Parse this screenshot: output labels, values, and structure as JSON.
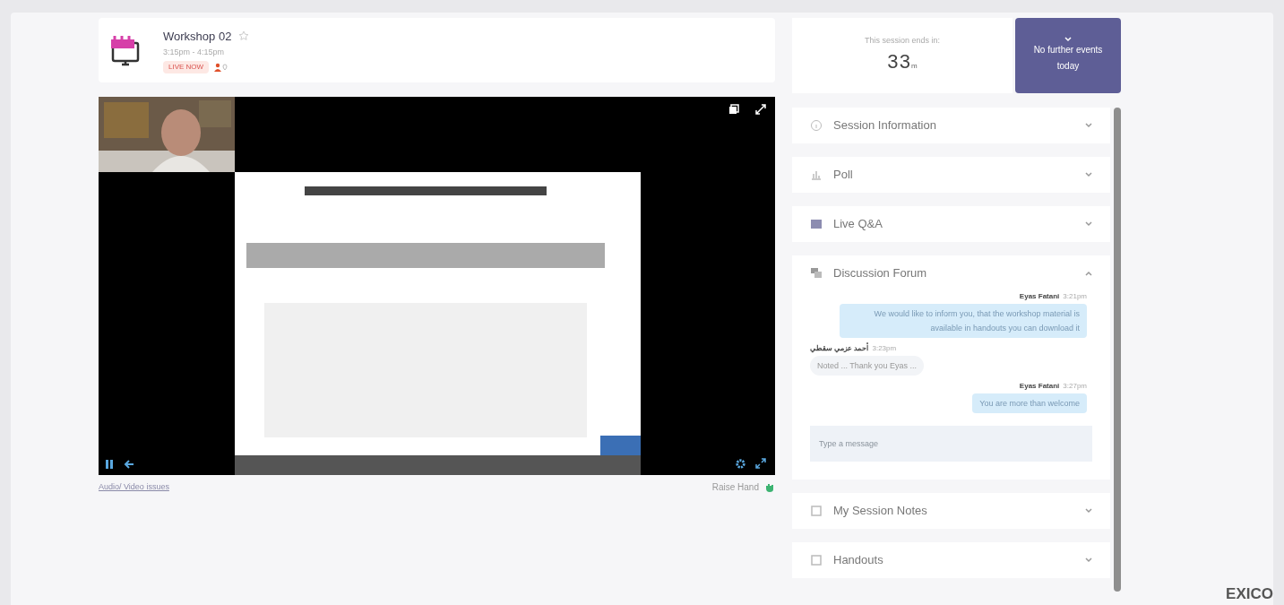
{
  "event": {
    "title": "Workshop 02",
    "time": "3:15pm - 4:15pm",
    "badge": "LIVE NOW"
  },
  "player": {
    "paused": false
  },
  "links": {
    "issues": "Audio/ Video issues",
    "raise_hand": "Raise Hand"
  },
  "countdown": {
    "label": "This session ends in:",
    "value": "33",
    "unit": "m"
  },
  "next_events": "No further events today",
  "sections": [
    {
      "title": "Session Information",
      "expanded": false
    },
    {
      "title": "Poll",
      "expanded": false
    },
    {
      "title": "Live Q&A",
      "expanded": false
    },
    {
      "title": "Discussion Forum",
      "expanded": true
    },
    {
      "title": "My Session Notes",
      "expanded": false
    },
    {
      "title": "Handouts",
      "expanded": false
    }
  ],
  "forum": {
    "messages": [
      {
        "author": "Eyas Fatani",
        "time": "3:21pm",
        "text": "We would like to inform you, that the workshop material is available in handouts you can download it",
        "own": true
      },
      {
        "author": "أحمد عزمي سقطي",
        "time": "3:23pm",
        "text": "Noted ... Thank you Eyas ...",
        "own": false
      },
      {
        "author": "Eyas Fatani",
        "time": "3:27pm",
        "text": "You are more than welcome",
        "own": true
      }
    ],
    "placeholder": "Type a message"
  },
  "brand": "EXICO"
}
